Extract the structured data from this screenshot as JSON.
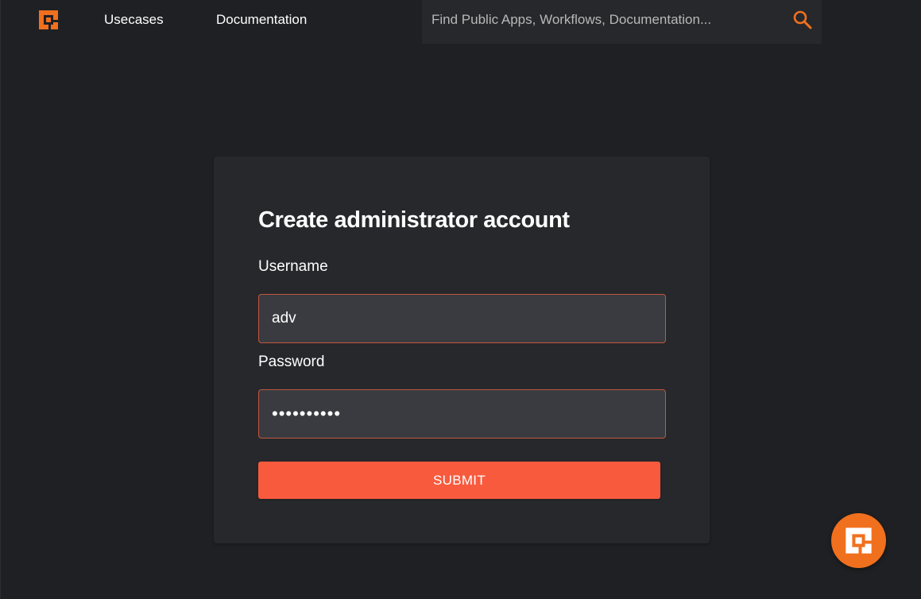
{
  "nav": {
    "links": [
      {
        "label": "Usecases"
      },
      {
        "label": "Documentation"
      }
    ],
    "search": {
      "placeholder": "Find Public Apps, Workflows, Documentation...",
      "icon": "search-icon"
    },
    "logo_icon": "shuffle-logo-icon"
  },
  "form": {
    "title": "Create administrator account",
    "username": {
      "label": "Username",
      "value": "adv"
    },
    "password": {
      "label": "Password",
      "value": "••••••••••"
    },
    "submit_label": "SUBMIT"
  },
  "fab": {
    "icon": "shuffle-logo-icon"
  },
  "colors": {
    "background": "#1f2023",
    "card": "#27282c",
    "accent": "#f85a3e",
    "logo_orange": "#f0701e",
    "field_border": "#c0573f"
  }
}
